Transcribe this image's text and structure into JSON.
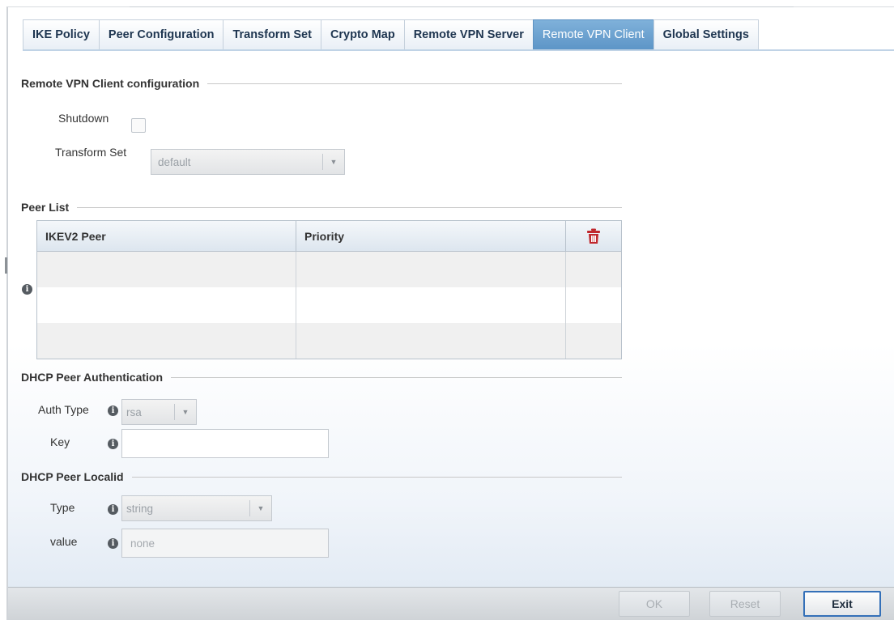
{
  "tabs": [
    {
      "label": "IKE Policy",
      "active": false
    },
    {
      "label": "Peer Configuration",
      "active": false
    },
    {
      "label": "Transform Set",
      "active": false
    },
    {
      "label": "Crypto Map",
      "active": false
    },
    {
      "label": "Remote VPN Server",
      "active": false
    },
    {
      "label": "Remote VPN Client",
      "active": true
    },
    {
      "label": "Global Settings",
      "active": false
    }
  ],
  "client_config": {
    "title": "Remote VPN Client configuration",
    "shutdown_label": "Shutdown",
    "shutdown_checked": false,
    "transform_set_label": "Transform Set",
    "transform_set_value": "default"
  },
  "peer_list": {
    "title": "Peer List",
    "columns": [
      "IKEV2 Peer",
      "Priority"
    ],
    "rows": [],
    "delete_icon": "trash-icon"
  },
  "dhcp_auth": {
    "title": "DHCP Peer Authentication",
    "auth_type_label": "Auth Type",
    "auth_type_value": "rsa",
    "key_label": "Key",
    "key_value": ""
  },
  "dhcp_localid": {
    "title": "DHCP Peer Localid",
    "type_label": "Type",
    "type_value": "string",
    "value_label": "value",
    "value_placeholder": "none"
  },
  "buttons": {
    "ok": "OK",
    "reset": "Reset",
    "exit": "Exit"
  },
  "colors": {
    "active_tab": "#6a9fcf",
    "delete_icon": "#c0282d",
    "exit_border": "#3470b8"
  }
}
